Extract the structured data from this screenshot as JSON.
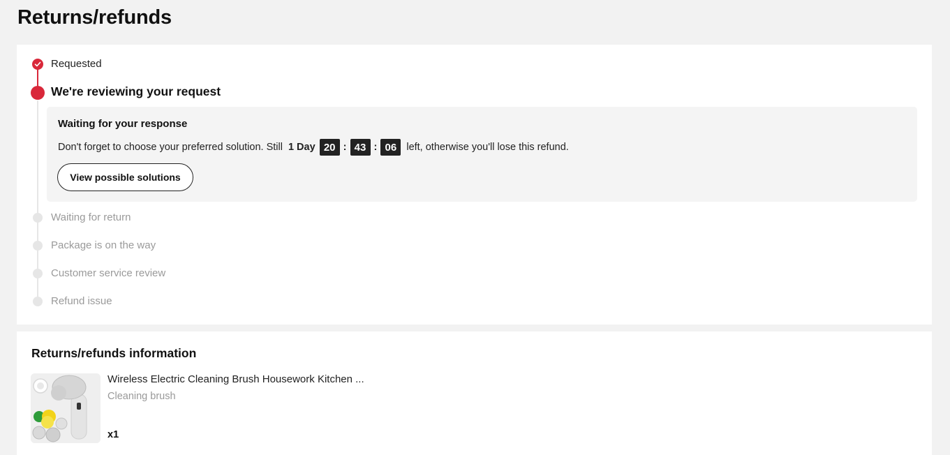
{
  "page": {
    "title": "Returns/refunds"
  },
  "timeline": {
    "steps": [
      {
        "label": "Requested",
        "status": "done"
      },
      {
        "label": "We're reviewing your request",
        "status": "current"
      },
      {
        "label": "Waiting for return",
        "status": "pending"
      },
      {
        "label": "Package is on the way",
        "status": "pending"
      },
      {
        "label": "Customer service review",
        "status": "pending"
      },
      {
        "label": "Refund issue",
        "status": "pending"
      }
    ],
    "notice": {
      "title": "Waiting for your response",
      "text_before": "Don't forget to choose your preferred solution. Still",
      "countdown": {
        "day": "1 Day",
        "hours": "20",
        "minutes": "43",
        "seconds": "06",
        "separator": ":"
      },
      "text_after": "left, otherwise you'll lose this refund.",
      "button_label": "View possible solutions"
    }
  },
  "info": {
    "title": "Returns/refunds information",
    "product": {
      "name": "Wireless Electric Cleaning Brush Housework Kitchen ...",
      "variant": "Cleaning brush",
      "quantity": "x1"
    }
  },
  "colors": {
    "accent": "#d9283a",
    "pending": "#e6e6e6",
    "background": "#f2f2f2"
  }
}
